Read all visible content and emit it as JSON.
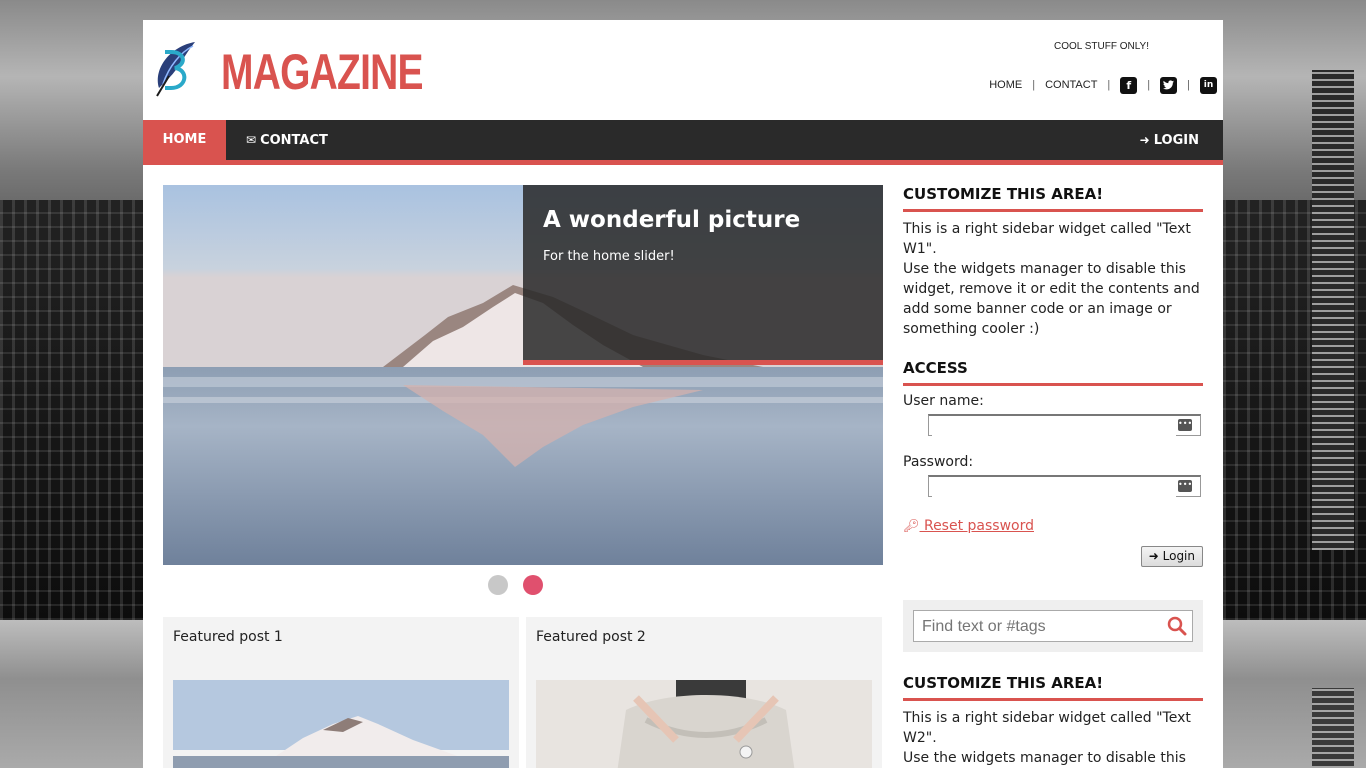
{
  "header": {
    "logo_text": "MAGAZINE",
    "tagline": "COOL STUFF ONLY!",
    "toplinks": {
      "home": "HOME",
      "contact": "CONTACT"
    },
    "social": {
      "facebook": "f",
      "twitter": "t",
      "linkedin": "in"
    }
  },
  "nav": {
    "home": "HOME",
    "contact": "CONTACT",
    "login": "LOGIN"
  },
  "slider": {
    "title": "A wonderful picture",
    "subtitle": "For the home slider!",
    "active_dot": 2,
    "dot_count": 2
  },
  "featured": [
    {
      "title": "Featured post 1"
    },
    {
      "title": "Featured post 2"
    }
  ],
  "sidebar": {
    "widget1": {
      "title": "CUSTOMIZE THIS AREA!",
      "text1": "This is a right sidebar widget called \"Text W1\".",
      "text2": "Use the widgets manager to disable this widget, remove it or edit the contents and add some banner code or an image or something cooler :)"
    },
    "access": {
      "title": "ACCESS",
      "username_label": "User name:",
      "password_label": "Password:",
      "reset_label": " Reset password",
      "login_label": "Login"
    },
    "search": {
      "placeholder": "Find text or #tags"
    },
    "widget2": {
      "title": "CUSTOMIZE THIS AREA!",
      "text1": "This is a right sidebar widget called \"Text W2\".",
      "text2": "Use the widgets manager to disable this"
    }
  },
  "colors": {
    "accent": "#d9534f",
    "nav_bg": "#2a2a2a",
    "dot_active": "#e0506e"
  }
}
